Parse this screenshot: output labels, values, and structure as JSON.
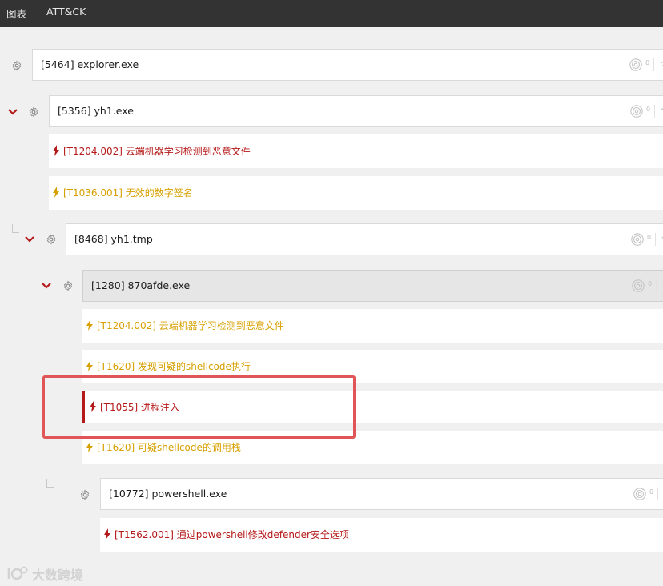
{
  "colors": {
    "topbar_bg": "#333333",
    "alert_red": "#b51919",
    "alert_yellow": "#d7a000",
    "annotation": "#e05658"
  },
  "nav": {
    "tabs": [
      {
        "label": "图表"
      },
      {
        "label": "ATT&CK"
      }
    ]
  },
  "tree": {
    "processes": [
      {
        "title": "[5464] explorer.exe",
        "count": "0",
        "expanded": false
      },
      {
        "title": "[5356] yh1.exe",
        "count": "0",
        "expanded": true
      },
      {
        "title": "[8468] yh1.tmp",
        "count": "0",
        "expanded": true
      },
      {
        "title": "[1280] 870afde.exe",
        "count": "0",
        "expanded": true,
        "selected": true
      },
      {
        "title": "[10772] powershell.exe",
        "count": "0",
        "expanded": false
      }
    ],
    "alerts": [
      {
        "text": "[T1204.002] 云端机器学习检测到恶意文件",
        "severity": "red"
      },
      {
        "text": "[T1036.001] 无效的数字签名",
        "severity": "yellow"
      },
      {
        "text": "[T1204.002] 云端机器学习检测到恶意文件",
        "severity": "yellow"
      },
      {
        "text": "[T1620] 发现可疑的shellcode执行",
        "severity": "yellow"
      },
      {
        "text": "[T1055] 进程注入",
        "severity": "red",
        "highlighted": true
      },
      {
        "text": "[T1620] 可疑shellcode的调用栈",
        "severity": "yellow"
      },
      {
        "text": "[T1562.001] 通过powershell修改defender安全选项",
        "severity": "red"
      }
    ]
  },
  "icons": {
    "expand": "chevron-down-icon",
    "process": "gear-icon",
    "alert": "lightning-icon",
    "fingerprint": "fingerprint-icon",
    "signal": "wifi-icon"
  },
  "watermark": {
    "text": "大数跨境"
  }
}
